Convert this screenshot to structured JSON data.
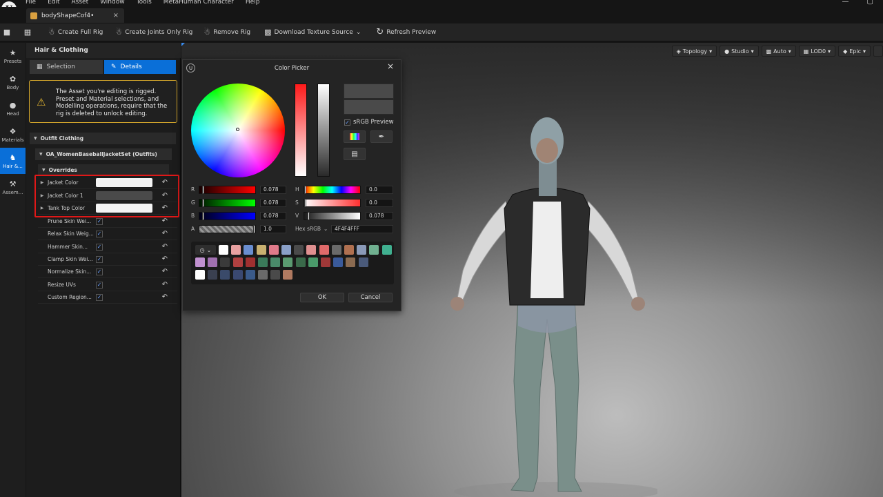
{
  "menu": [
    "File",
    "Edit",
    "Asset",
    "Window",
    "Tools",
    "MetaHuman Character",
    "Help"
  ],
  "window_controls": [
    "—",
    "▢"
  ],
  "document_tab": {
    "title": "bodyShapeCof4•",
    "close": "×"
  },
  "toolbar": {
    "create_full_rig": "Create Full Rig",
    "create_joints_only_rig": "Create Joints Only Rig",
    "remove_rig": "Remove Rig",
    "download_texture_source": "Download Texture Source",
    "refresh_preview": "Refresh Preview"
  },
  "iconbar": [
    {
      "label": "Presets",
      "icon": "star-icon"
    },
    {
      "label": "Body",
      "icon": "body-icon"
    },
    {
      "label": "Head",
      "icon": "head-icon"
    },
    {
      "label": "Materials",
      "icon": "materials-icon"
    },
    {
      "label": "Hair &...",
      "icon": "hair-icon"
    },
    {
      "label": "Assem...",
      "icon": "hammer-icon"
    }
  ],
  "panel": {
    "title": "Hair & Clothing",
    "tab_selection": "Selection",
    "tab_details": "Details",
    "warning": "The Asset you're editing is rigged. Preset and Material selections, and Modelling operations, require that the rig is deleted to unlock editing.",
    "section_outfit": "Outfit Clothing",
    "section_asset": "OA_WomenBaseballJacketSet (Outfits)",
    "section_overrides": "Overrides",
    "color_rows": [
      {
        "label": "Jacket Color",
        "color": "#f4f4f4"
      },
      {
        "label": "Jacket Color 1",
        "color": "#4a4a4a"
      },
      {
        "label": "Tank Top Color",
        "color": "#f4f4f4"
      }
    ],
    "bool_rows": [
      {
        "label": "Prune Skin Wei...",
        "checked": "✓"
      },
      {
        "label": "Relax Skin Weig...",
        "checked": "✓"
      },
      {
        "label": "Hammer Skin...",
        "checked": "✓"
      },
      {
        "label": "Clamp Skin Wei...",
        "checked": "✓"
      },
      {
        "label": "Normalize Skin...",
        "checked": "✓"
      },
      {
        "label": "Resize UVs",
        "checked": "✓"
      },
      {
        "label": "Custom Region...",
        "checked": "✓"
      }
    ]
  },
  "viewport": {
    "buttons": [
      "Topology",
      "Studio",
      "Auto",
      "LOD0",
      "Epic"
    ]
  },
  "color_picker": {
    "title": "Color Picker",
    "close": "×",
    "srgb_preview": "sRGB Preview",
    "r_label": "R",
    "r_value": "0.078",
    "g_label": "G",
    "g_value": "0.078",
    "b_label": "B",
    "b_value": "0.078",
    "a_label": "A",
    "a_value": "1.0",
    "h_label": "H",
    "h_value": "0.0",
    "s_label": "S",
    "s_value": "0.0",
    "v_label": "V",
    "v_value": "0.078",
    "hex_label": "Hex sRGB",
    "hex_value": "4F4F4FFF",
    "ok": "OK",
    "cancel": "Cancel",
    "palette": [
      "#ffffff",
      "#e8a0a0",
      "#6a8ed0",
      "#c8b070",
      "#e07a8a",
      "#8aa0c8",
      "#4a4a4a",
      "#e09090",
      "#e06a6a",
      "#6a6a6a",
      "#b07050",
      "#8a9ab8",
      "#70b090",
      "#40b090",
      "#c090d0",
      "#a070b0",
      "#3a3a3a",
      "#b04040",
      "#a03030",
      "#3a7a5a",
      "#4a8a6a",
      "#5a9a70",
      "#3a6a4a",
      "#4a9a6a",
      "#a03838",
      "#3a5a9a",
      "#8a6a50",
      "#4a5a7a",
      "#ffffff",
      "#3a4050",
      "#3a4a6a",
      "#3a4870",
      "#3a5a8a",
      "#6a6a6a",
      "#4a4a4a",
      "#b07a60"
    ]
  }
}
